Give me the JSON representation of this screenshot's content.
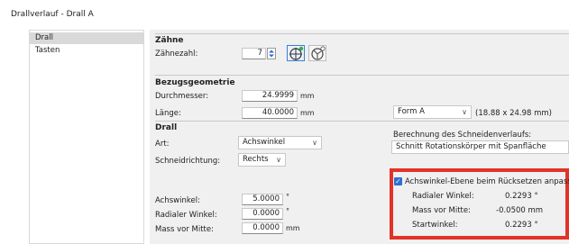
{
  "window": {
    "title": "Drallverlauf - Drall A"
  },
  "sidebar": {
    "items": [
      {
        "label": "Drall",
        "selected": true
      },
      {
        "label": "Tasten",
        "selected": false
      }
    ]
  },
  "zaehne": {
    "title": "Zähne",
    "count_label": "Zähnezahl:",
    "count_value": "7"
  },
  "bezug": {
    "title": "Bezugsgeometrie",
    "durchmesser_label": "Durchmesser:",
    "durchmesser_value": "24.9999",
    "durchmesser_unit": "mm",
    "laenge_label": "Länge:",
    "laenge_value": "40.0000",
    "laenge_unit": "mm",
    "form_value": "Form A",
    "form_info": "(18.88 x 24.98 mm)"
  },
  "drall": {
    "title": "Drall",
    "art_label": "Art:",
    "art_value": "Achswinkel",
    "richtung_label": "Schneidrichtung:",
    "richtung_value": "Rechts",
    "berechnung_label": "Berechnung des Schneidenverlaufs:",
    "berechnung_value": "Schnitt Rotationskörper mit Spanfläche",
    "achswinkel_label": "Achswinkel:",
    "achswinkel_value": "5.0000",
    "achswinkel_unit": "°",
    "radial_label": "Radialer Winkel:",
    "radial_value": "0.0000",
    "radial_unit": "°",
    "mass_label": "Mass vor Mitte:",
    "mass_value": "0.0000",
    "mass_unit": "mm"
  },
  "adjust": {
    "checkbox_label": "Achswinkel-Ebene beim Rücksetzen anpassen",
    "checked": true,
    "radial_label": "Radialer Winkel:",
    "radial_value": "0.2293 °",
    "mass_label": "Mass vor Mitte:",
    "mass_value": "-0.0500 mm",
    "start_label": "Startwinkel:",
    "start_value": "0.2293 °"
  },
  "colors": {
    "highlight": "#e23327",
    "checkbox": "#2e6fd1",
    "panel": "#f0f0f0"
  },
  "icons": [
    "arrow-up-icon",
    "arrow-down-icon",
    "cutter-view-icon",
    "cutter-view-alt-icon"
  ]
}
